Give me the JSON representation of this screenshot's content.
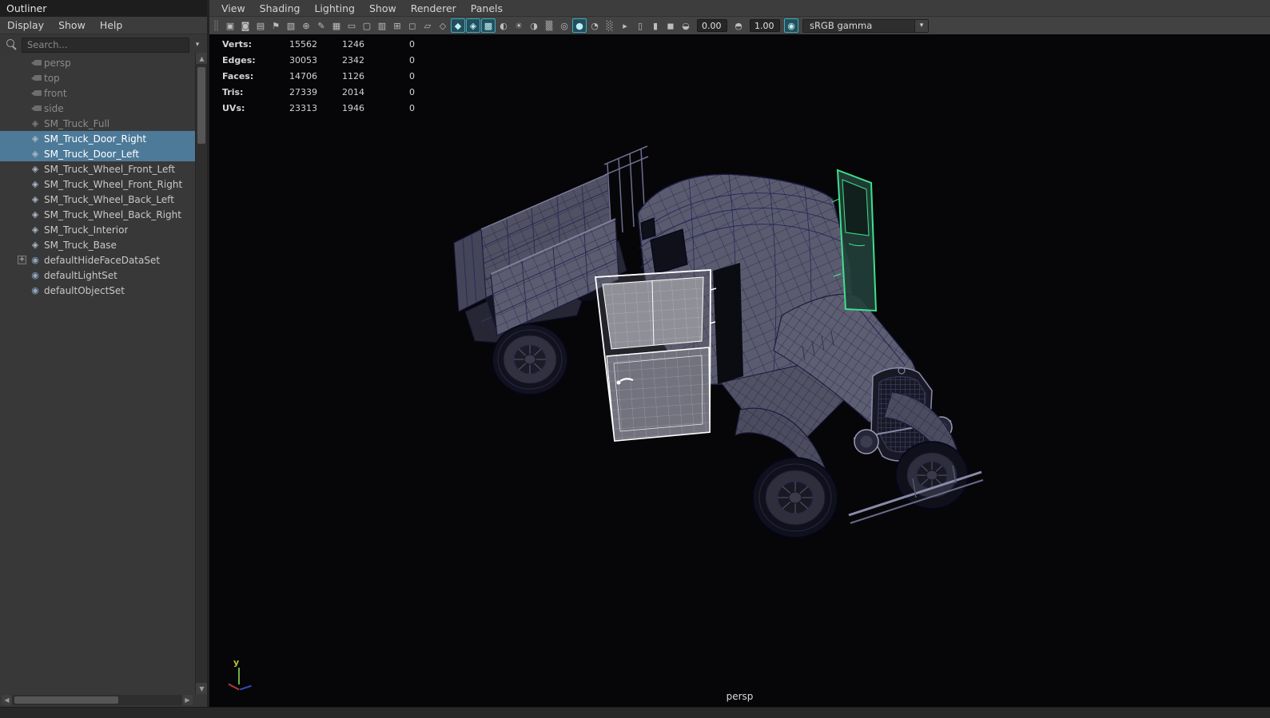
{
  "colors": {
    "selection_blue": "#4d7a99",
    "active_toggle_teal": "#3fa9bd",
    "selected_door_white": "#ffffff",
    "selected_door_green": "#3fe08c",
    "wireframe_navy": "#20204b"
  },
  "outliner": {
    "title": "Outliner",
    "menus": [
      {
        "label": "Display"
      },
      {
        "label": "Show"
      },
      {
        "label": "Help"
      }
    ],
    "search": {
      "placeholder": "Search..."
    },
    "items": [
      {
        "label": "persp",
        "icon": "camera-icon",
        "state": "muted"
      },
      {
        "label": "top",
        "icon": "camera-icon",
        "state": "muted"
      },
      {
        "label": "front",
        "icon": "camera-icon",
        "state": "muted"
      },
      {
        "label": "side",
        "icon": "camera-icon",
        "state": "muted"
      },
      {
        "label": "SM_Truck_Full",
        "icon": "mesh-icon",
        "state": "muted"
      },
      {
        "label": "SM_Truck_Door_Right",
        "icon": "mesh-icon",
        "state": "selected"
      },
      {
        "label": "SM_Truck_Door_Left",
        "icon": "mesh-icon",
        "state": "selected"
      },
      {
        "label": "SM_Truck_Wheel_Front_Left",
        "icon": "mesh-icon",
        "state": "normal"
      },
      {
        "label": "SM_Truck_Wheel_Front_Right",
        "icon": "mesh-icon",
        "state": "normal"
      },
      {
        "label": "SM_Truck_Wheel_Back_Left",
        "icon": "mesh-icon",
        "state": "normal"
      },
      {
        "label": "SM_Truck_Wheel_Back_Right",
        "icon": "mesh-icon",
        "state": "normal"
      },
      {
        "label": "SM_Truck_Interior",
        "icon": "mesh-icon",
        "state": "normal"
      },
      {
        "label": "SM_Truck_Base",
        "icon": "mesh-icon",
        "state": "normal"
      },
      {
        "label": "defaultHideFaceDataSet",
        "icon": "set-icon",
        "state": "normal",
        "expander": "+"
      },
      {
        "label": "defaultLightSet",
        "icon": "set-icon",
        "state": "normal"
      },
      {
        "label": "defaultObjectSet",
        "icon": "set-icon",
        "state": "normal"
      }
    ]
  },
  "viewport": {
    "menus": [
      {
        "label": "View"
      },
      {
        "label": "Shading"
      },
      {
        "label": "Lighting"
      },
      {
        "label": "Show"
      },
      {
        "label": "Renderer"
      },
      {
        "label": "Panels"
      }
    ],
    "toolbar": {
      "icons_main": [
        {
          "name": "select-camera-icon",
          "glyph": "▣"
        },
        {
          "name": "lock-camera-icon",
          "glyph": "◙"
        },
        {
          "name": "camera-attributes-icon",
          "glyph": "▤"
        },
        {
          "name": "bookmarks-icon",
          "glyph": "⚑"
        },
        {
          "name": "image-plane-icon",
          "glyph": "▧"
        },
        {
          "name": "two-d-pan-zoom-icon",
          "glyph": "⊕"
        },
        {
          "name": "grease-pencil-icon",
          "glyph": "✎"
        },
        {
          "name": "grid-icon",
          "glyph": "▦"
        },
        {
          "name": "film-gate-icon",
          "glyph": "▭"
        },
        {
          "name": "resolution-gate-icon",
          "glyph": "▢"
        },
        {
          "name": "gate-mask-icon",
          "glyph": "▥"
        },
        {
          "name": "field-chart-icon",
          "glyph": "⊞"
        },
        {
          "name": "safe-action-icon",
          "glyph": "◻"
        },
        {
          "name": "safe-title-icon",
          "glyph": "▱"
        },
        {
          "name": "wireframe-icon",
          "glyph": "◇"
        },
        {
          "name": "smooth-shade-icon",
          "glyph": "◆",
          "state": "active"
        },
        {
          "name": "wireframe-on-shaded-icon",
          "glyph": "◈",
          "state": "active"
        },
        {
          "name": "textured-icon",
          "glyph": "▩",
          "state": "active"
        },
        {
          "name": "use-default-material-icon",
          "glyph": "◐"
        },
        {
          "name": "lighting-all-icon",
          "glyph": "☀"
        },
        {
          "name": "shadows-icon",
          "glyph": "◑"
        },
        {
          "name": "xray-icon",
          "glyph": "▒"
        },
        {
          "name": "xray-active-components-icon",
          "glyph": "◎"
        },
        {
          "name": "occlusion-icon",
          "glyph": "●",
          "state": "active"
        },
        {
          "name": "motion-blur-icon",
          "glyph": "◔"
        },
        {
          "name": "multisample-icon",
          "glyph": "░"
        },
        {
          "name": "select-tool-icon",
          "glyph": "▸"
        },
        {
          "name": "copy-view-icon",
          "glyph": "▯"
        },
        {
          "name": "paste-view-icon",
          "glyph": "▮"
        },
        {
          "name": "isolate-select-icon",
          "glyph": "◼"
        },
        {
          "name": "exposure-icon",
          "glyph": "◒"
        }
      ],
      "icons_gamma": [
        {
          "name": "gamma-icon",
          "glyph": "◓"
        }
      ],
      "icons_color": [
        {
          "name": "color-management-icon",
          "glyph": "◉",
          "state": "active"
        }
      ],
      "exposure_value": "0.00",
      "gamma_value": "1.00",
      "view_transform": "sRGB gamma"
    },
    "hud": {
      "rows": [
        {
          "label": "Verts:",
          "v1": "15562",
          "v2": "1246",
          "v3": "0"
        },
        {
          "label": "Edges:",
          "v1": "30053",
          "v2": "2342",
          "v3": "0"
        },
        {
          "label": "Faces:",
          "v1": "14706",
          "v2": "1126",
          "v3": "0"
        },
        {
          "label": "Tris:",
          "v1": "27339",
          "v2": "2014",
          "v3": "0"
        },
        {
          "label": "UVs:",
          "v1": "23313",
          "v2": "1946",
          "v3": "0"
        }
      ]
    },
    "camera_label": "persp",
    "axis_label": "y"
  }
}
